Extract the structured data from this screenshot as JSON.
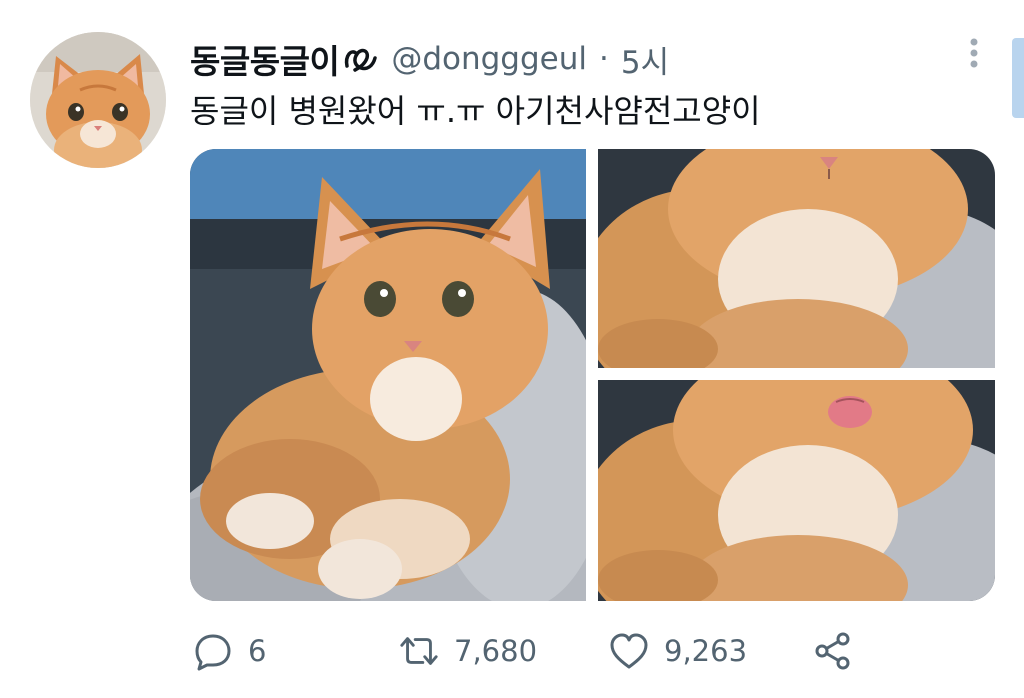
{
  "tweet": {
    "author": {
      "display_name": "동글동글이",
      "handle": "@dongggeul",
      "avatar_icon": "orange-kitten-avatar"
    },
    "separator": "·",
    "time": "5시",
    "text": "동글이 병원왔어 ㅠ.ㅠ 아기천사얌전고양이",
    "media": [
      {
        "icon": "orange-kitten-photo-full"
      },
      {
        "icon": "orange-kitten-photo-chin"
      },
      {
        "icon": "orange-kitten-photo-tongue"
      }
    ],
    "actions": {
      "reply_count": "6",
      "retweet_count": "7,680",
      "like_count": "9,263"
    }
  },
  "colors": {
    "text": "#0f1419",
    "secondary": "#536471",
    "kitten_orange": "#e0a063",
    "blanket": "#b8bcc4"
  }
}
